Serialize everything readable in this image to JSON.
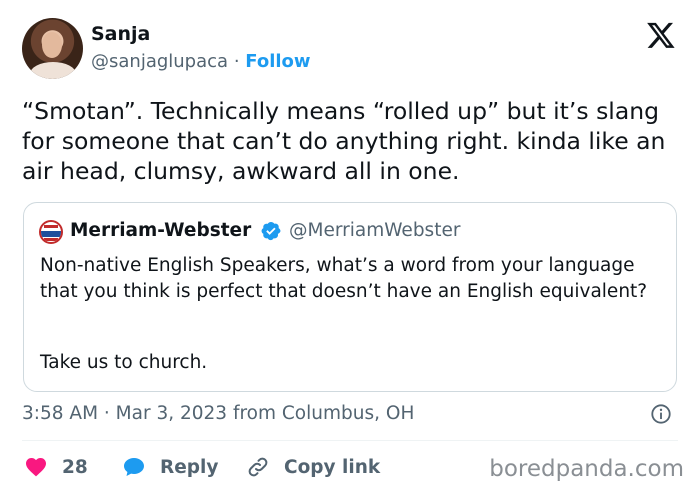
{
  "author": {
    "name": "Sanja",
    "handle": "@sanjaglupaca",
    "separator": "·",
    "follow_label": "Follow"
  },
  "tweet": {
    "text": "“Smotan”. Technically means “rolled up” but it’s slang for someone that can’t do anything right. kinda like an air head, clumsy, awkward all in one."
  },
  "quoted_tweet": {
    "name": "Merriam-Webster",
    "handle": "@MerriamWebster",
    "text": "Non-native English Speakers, what’s a word from your language that you think is perfect that doesn’t have an English equivalent?",
    "text_2": "Take us to church.",
    "verified_color": "#1d9bf0"
  },
  "meta": {
    "timestamp": "3:58 AM · Mar 3, 2023 from Columbus, OH"
  },
  "actions": {
    "like_count": "28",
    "reply_label": "Reply",
    "copy_link_label": "Copy link",
    "like_color": "#f91880",
    "reply_color": "#1d9bf0"
  },
  "watermark": "boredpanda.com",
  "icons": [
    "x-logo-icon",
    "verified-badge-icon",
    "info-icon",
    "heart-icon",
    "reply-bubble-icon",
    "link-icon"
  ]
}
